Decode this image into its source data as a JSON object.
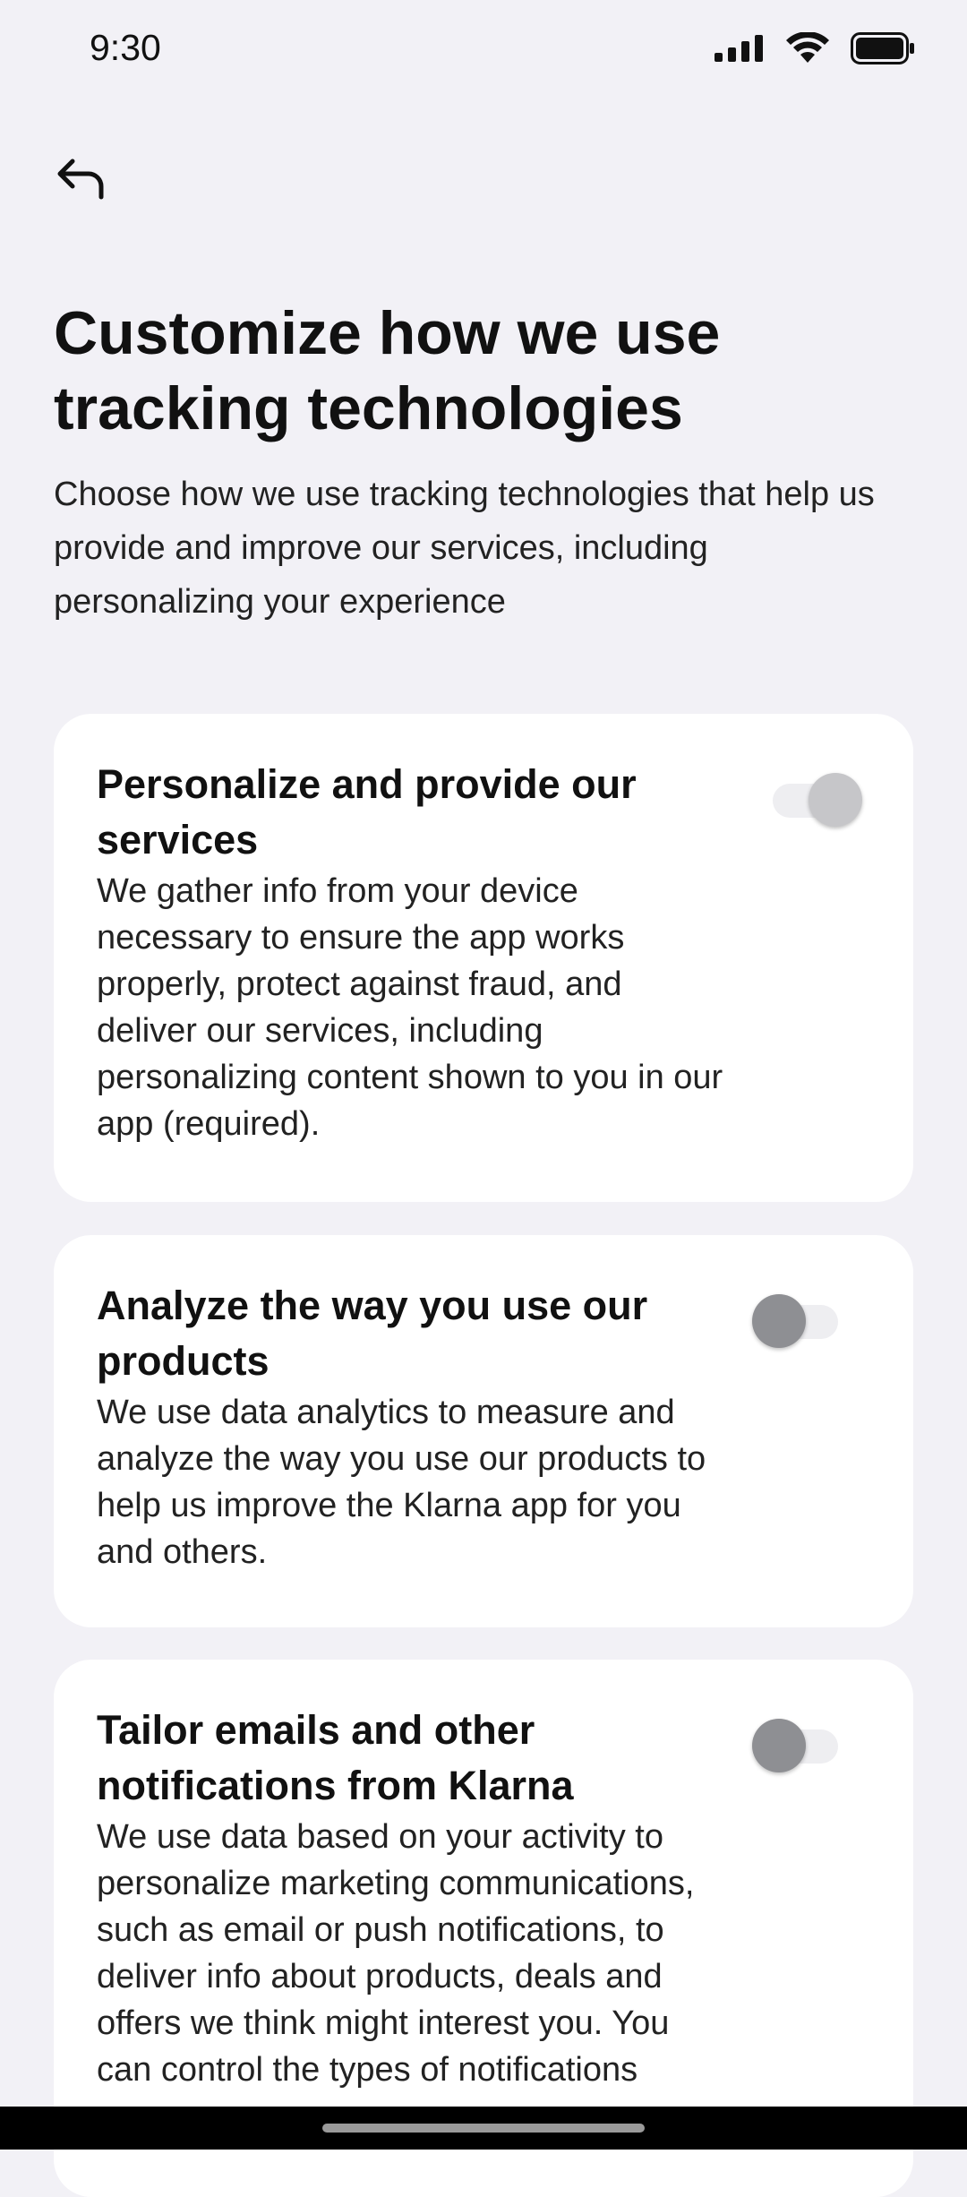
{
  "status_bar": {
    "time": "9:30"
  },
  "header": {
    "back_icon": "back-arrow-icon"
  },
  "page": {
    "title": "Customize how we use tracking technologies",
    "subtitle": "Choose how we use tracking technologies that help us provide and improve our services, including personalizing your experience"
  },
  "cards": [
    {
      "title": "Personalize and provide our services",
      "description": "We gather info from your device necessary to ensure the app works properly, protect against fraud, and deliver our services, including personalizing content shown to you in our app (required).",
      "toggle_state": "on-disabled"
    },
    {
      "title": "Analyze the way you use our products",
      "description": "We use data analytics to measure and analyze the way you use our products to help us improve the Klarna app for you and others.",
      "toggle_state": "off"
    },
    {
      "title": "Tailor emails and other notifications from Klarna",
      "description": "We use data based on your activity to personalize marketing communications, such as email or push notifications, to deliver info about products, deals and offers we think might interest you. You can control the types of notifications",
      "toggle_state": "off"
    }
  ],
  "colors": {
    "background": "#f2f1f6",
    "card": "#ffffff",
    "thumb_disabled": "#c6c6c9",
    "thumb_off": "#8e8f93",
    "track": "#eeeef1"
  }
}
